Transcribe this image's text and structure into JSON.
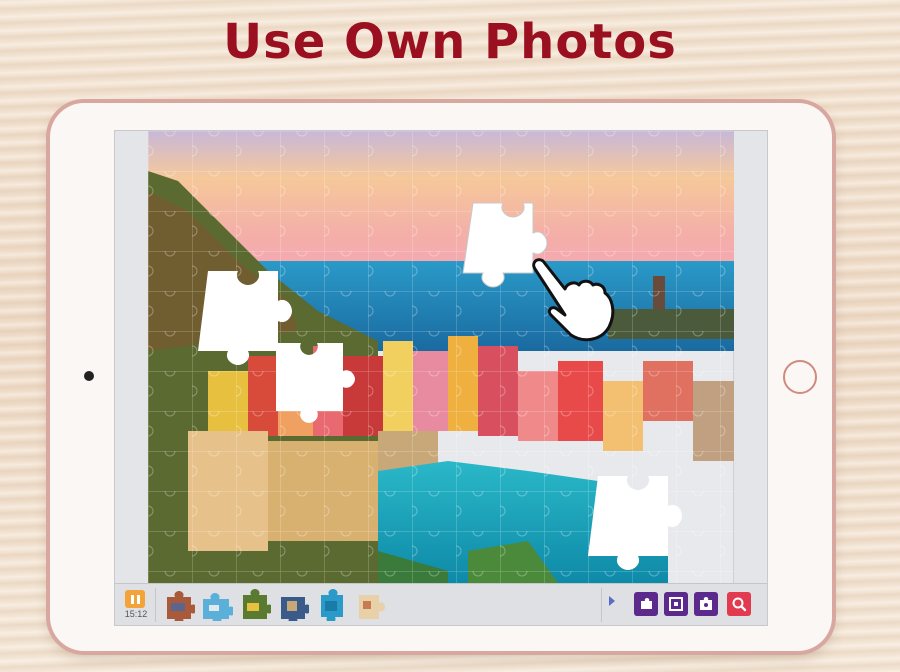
{
  "headline": "Use Own Photos",
  "toolbar": {
    "pause_icon": "pause-icon",
    "timer": "15:12",
    "tray_pieces": [
      "puzzle-piece-1",
      "puzzle-piece-2",
      "puzzle-piece-3",
      "puzzle-piece-4",
      "puzzle-piece-5",
      "puzzle-piece-6"
    ],
    "tools": [
      "sort-pieces-icon",
      "edge-pieces-icon",
      "ghost-image-icon",
      "search-icon"
    ]
  },
  "colors": {
    "headline": "#9a1020",
    "pause_button": "#f2a33a",
    "tool_button": "#5b2a8c",
    "search_button": "#e23a4e",
    "tablet_frame": "#d8a8a0"
  },
  "hand_icon": "pointing-hand-icon"
}
